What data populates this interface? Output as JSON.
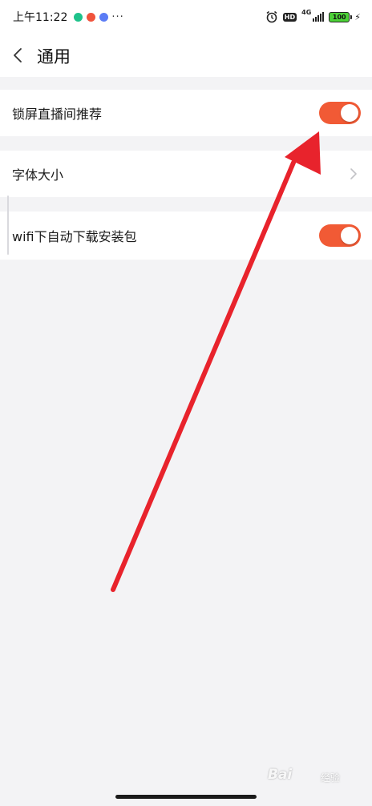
{
  "status_bar": {
    "time": "上午11:22",
    "network": "4G",
    "hd_badge": "HD",
    "battery": "100",
    "app_icon_colors": [
      "#1ec28b",
      "#f0533c",
      "#5b7cf5"
    ],
    "more": "···"
  },
  "header": {
    "title": "通用",
    "back_icon": "chevron-left-icon"
  },
  "settings": {
    "lockscreen_live": {
      "label": "锁屏直播间推荐",
      "enabled": true
    },
    "font_size": {
      "label": "字体大小",
      "icon": "chevron-right-icon"
    },
    "wifi_autodownload": {
      "label": "wifi下自动下载安装包",
      "enabled": true
    }
  },
  "colors": {
    "toggle_on": "#f15a35",
    "annotation_arrow": "#e8232c",
    "page_background": "#f3f3f5"
  },
  "watermark": {
    "brand": "Bai",
    "sub": "经验"
  }
}
